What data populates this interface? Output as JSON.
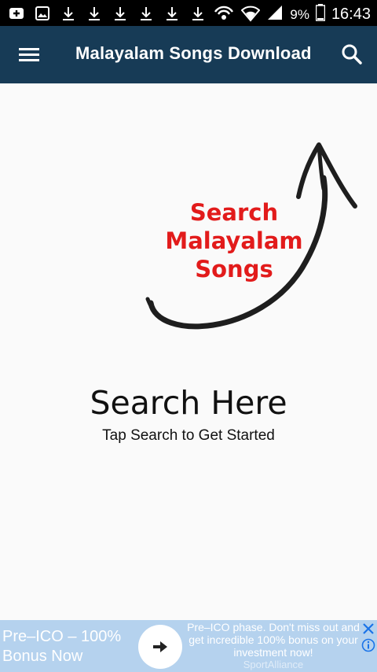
{
  "status_bar": {
    "battery_percent": "9%",
    "time": "16:43",
    "left_icons": [
      "add-icon",
      "image-icon",
      "download-icon",
      "download-icon",
      "download-icon",
      "download-icon",
      "download-icon",
      "download-icon"
    ],
    "right_icons": [
      "hotspot-icon",
      "wifi-icon",
      "signal-icon",
      "battery-icon"
    ]
  },
  "app_bar": {
    "title": "Malayalam Songs Download",
    "menu_icon": "menu-icon",
    "search_icon": "search-icon",
    "color": "#173b56"
  },
  "hero": {
    "lines": [
      "Search",
      "Malayalam",
      "Songs"
    ],
    "text_color": "#e21b1b"
  },
  "empty_state": {
    "title": "Search Here",
    "subtitle": "Tap Search to Get Started"
  },
  "ad": {
    "headline_line1": "Pre–ICO – 100%",
    "headline_line2": "Bonus Now",
    "body": "Pre–ICO phase. Don't miss out and get incredible 100% bonus on your investment now!",
    "sponsor": "SportAlliance",
    "background": "#b5d2ee"
  }
}
